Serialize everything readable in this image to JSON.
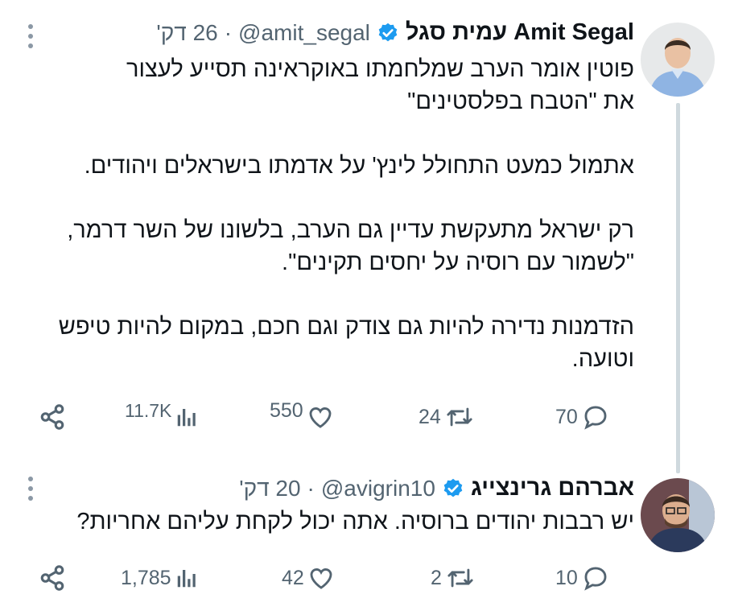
{
  "tweets": [
    {
      "name": "עמית סגל Amit Segal",
      "handle": "@amit_segal",
      "separator": "·",
      "time": "26 דק'",
      "paragraphs": [
        "פוטין אומר הערב שמלחמתו באוקראינה תסייע לעצור את \"הטבח בפלסטינים\"",
        "אתמול כמעט התחולל לינץ' על אדמתו בישראלים ויהודים.",
        "רק ישראל מתעקשת עדיין גם הערב, בלשונו של השר דרמר, \"לשמור עם רוסיה על יחסים תקינים\".",
        "הזדמנות נדירה להיות גם צודק וגם חכם, במקום להיות טיפש וטועה."
      ],
      "stats": {
        "views": "11.7K",
        "likes": "550",
        "retweets": "24",
        "replies": "70"
      }
    },
    {
      "name": "אברהם גרינצייג",
      "handle": "@avigrin10",
      "separator": "·",
      "time": "20 דק'",
      "paragraphs": [
        "יש רבבות יהודים ברוסיה. אתה יכול לקחת עליהם אחריות?"
      ],
      "stats": {
        "views": "1,785",
        "likes": "42",
        "retweets": "2",
        "replies": "10"
      }
    }
  ],
  "colors": {
    "text": "#0f1419",
    "muted": "#536471",
    "verified": "#1d9bf0",
    "thread_line": "#cfd9de"
  },
  "icons": [
    "share-icon",
    "views-icon",
    "like-icon",
    "retweet-icon",
    "reply-icon",
    "verified-icon",
    "more-icon"
  ]
}
